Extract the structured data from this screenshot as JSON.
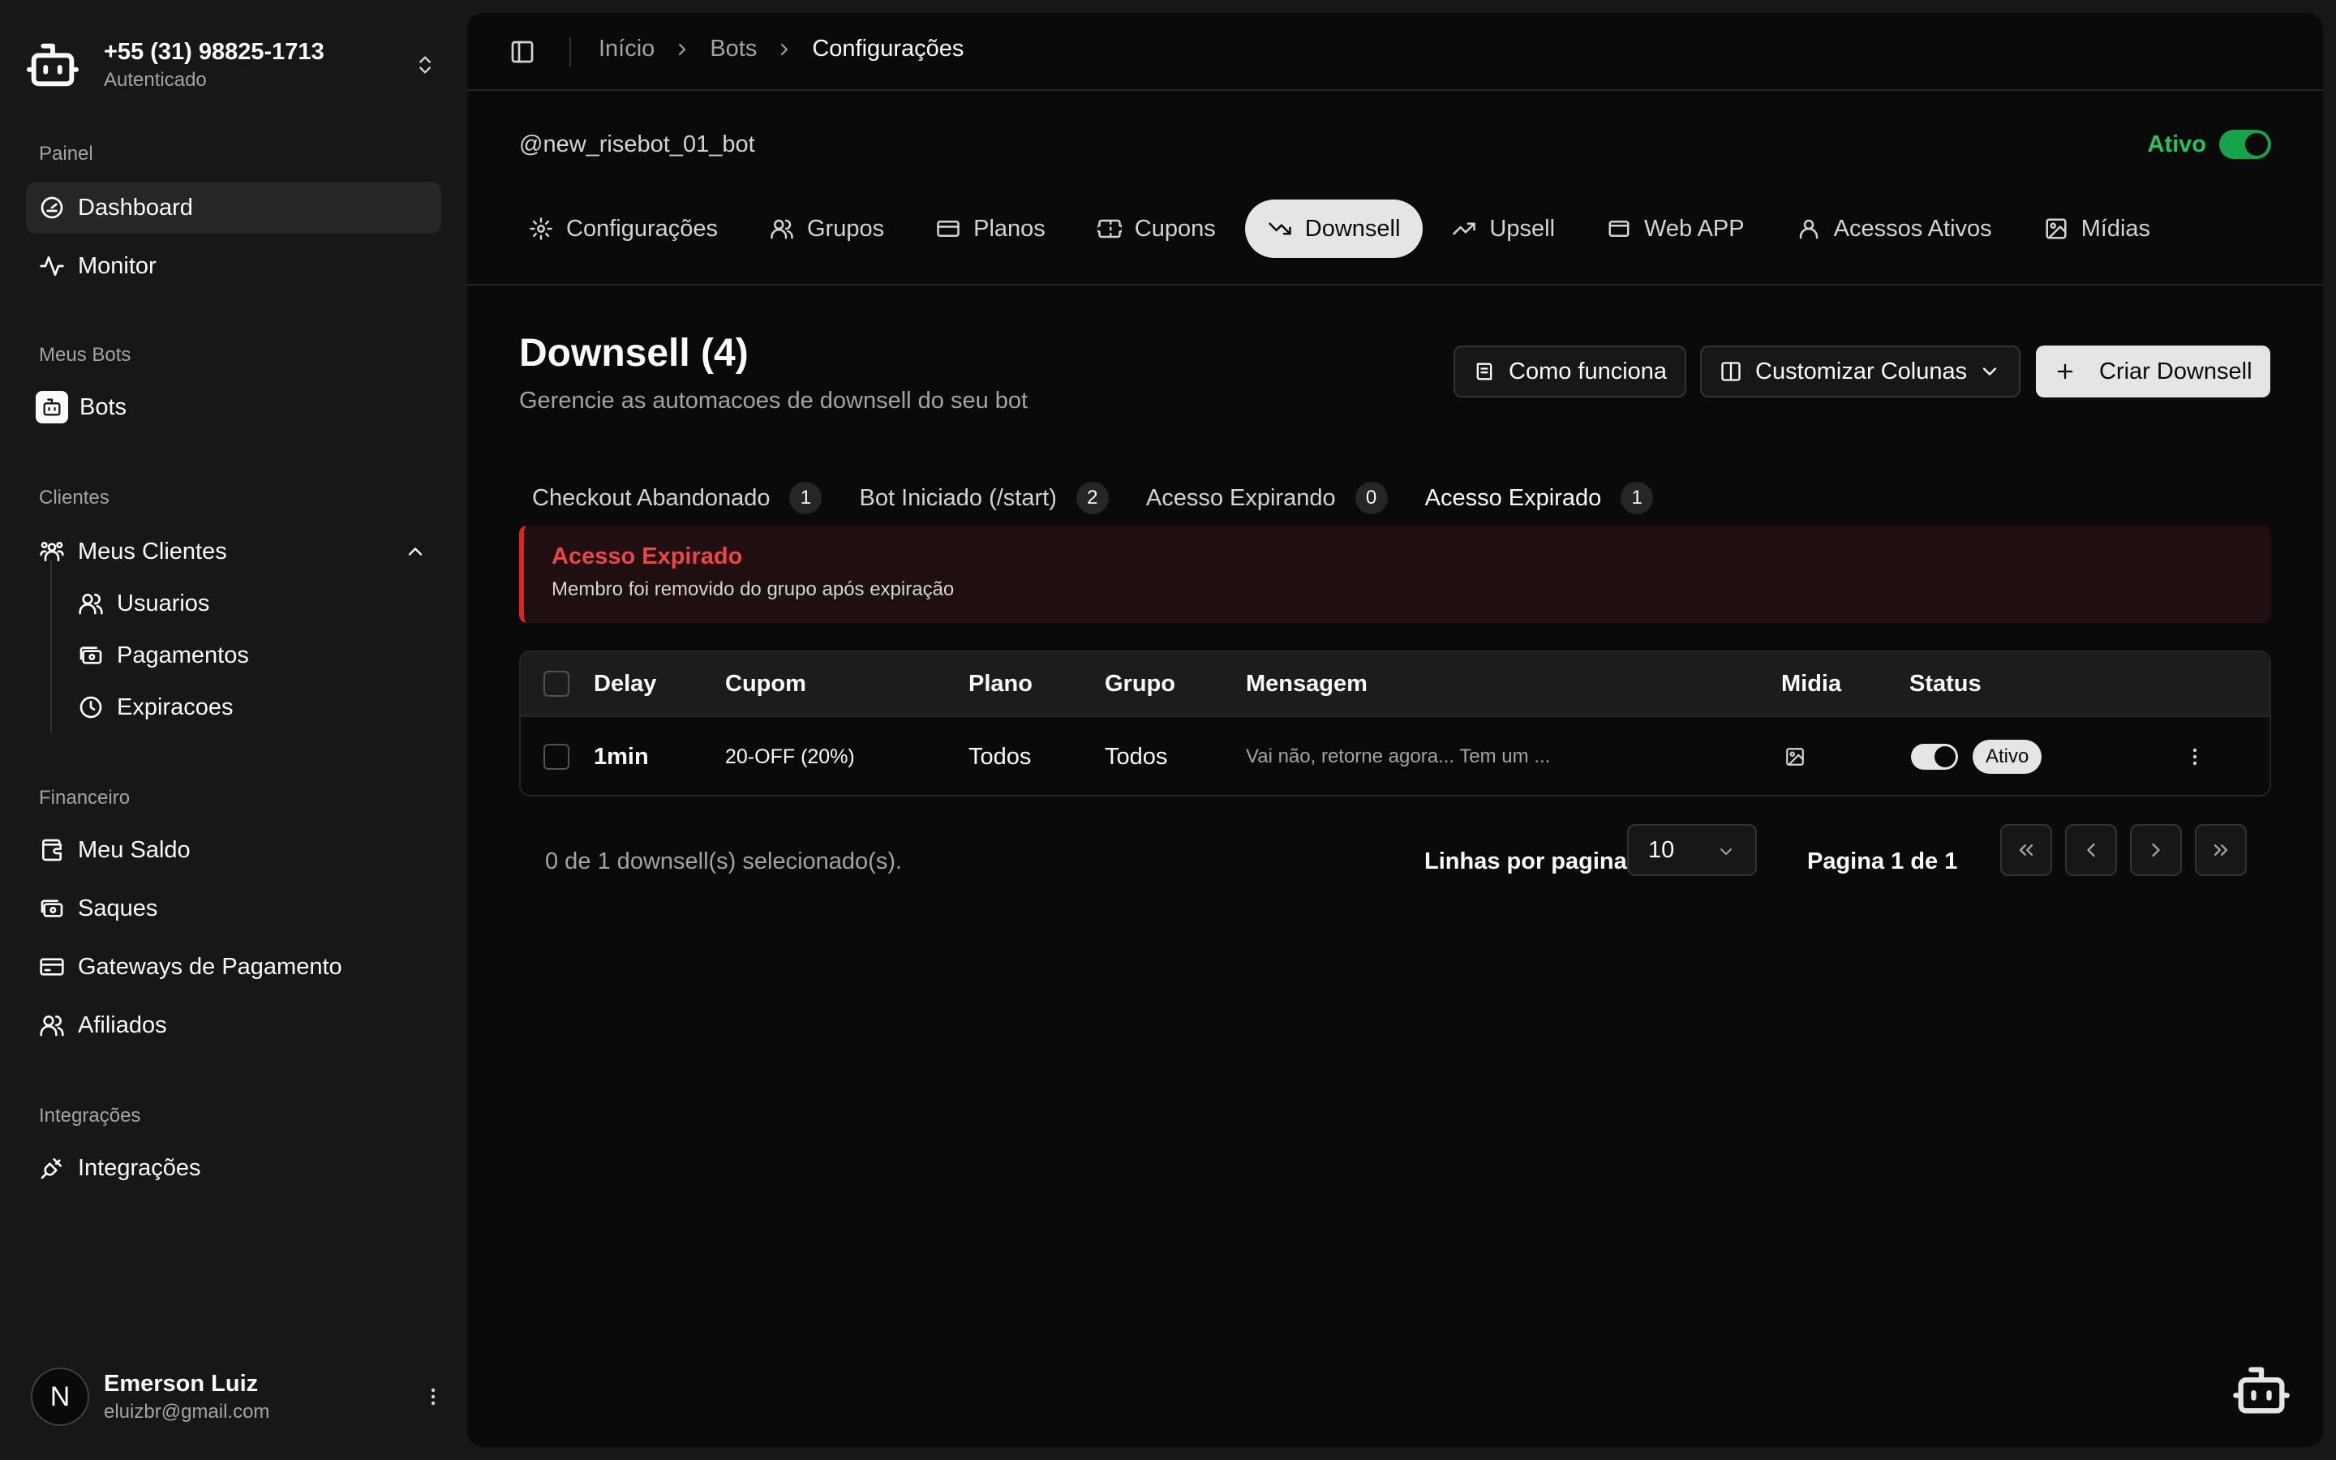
{
  "account": {
    "phone": "+55 (31) 98825-1713",
    "status": "Autenticado"
  },
  "sidebar": {
    "sections": [
      {
        "label": "Painel",
        "items": [
          {
            "label": "Dashboard",
            "icon": "gauge-icon"
          },
          {
            "label": "Monitor",
            "icon": "activity-icon"
          }
        ]
      },
      {
        "label": "Meus Bots",
        "items": [
          {
            "label": "Bots",
            "icon": "bot-icon"
          }
        ]
      },
      {
        "label": "Clientes",
        "items": [
          {
            "label": "Meus Clientes",
            "icon": "users-group-icon"
          }
        ],
        "subitems": [
          {
            "label": "Usuarios"
          },
          {
            "label": "Pagamentos"
          },
          {
            "label": "Expiracoes"
          }
        ]
      },
      {
        "label": "Financeiro",
        "items": [
          {
            "label": "Meu Saldo"
          },
          {
            "label": "Saques"
          },
          {
            "label": "Gateways de Pagamento"
          },
          {
            "label": "Afiliados"
          }
        ]
      },
      {
        "label": "Integrações",
        "items": [
          {
            "label": "Integrações"
          }
        ]
      }
    ]
  },
  "user": {
    "initial": "N",
    "name": "Emerson Luiz",
    "email": "eluizbr@gmail.com"
  },
  "breadcrumb": [
    "Início",
    "Bots",
    "Configurações"
  ],
  "bot": {
    "handle": "@new_risebot_01_bot",
    "status_label": "Ativo",
    "active": true
  },
  "tabs": [
    "Configurações",
    "Grupos",
    "Planos",
    "Cupons",
    "Downsell",
    "Upsell",
    "Web APP",
    "Acessos Ativos",
    "Mídias"
  ],
  "active_tab": "Downsell",
  "page": {
    "title": "Downsell (4)",
    "subtitle": "Gerencie as automacoes de downsell do seu bot",
    "btn_how": "Como funciona",
    "btn_columns": "Customizar Colunas",
    "btn_create": "Criar Downsell"
  },
  "subtabs": [
    {
      "label": "Checkout Abandonado",
      "count": "1"
    },
    {
      "label": "Bot Iniciado (/start)",
      "count": "2"
    },
    {
      "label": "Acesso Expirando",
      "count": "0"
    },
    {
      "label": "Acesso Expirado",
      "count": "1"
    }
  ],
  "alert": {
    "title": "Acesso Expirado",
    "description": "Membro foi removido do grupo após expiração",
    "color": "#ef4444"
  },
  "table": {
    "headers": [
      "Delay",
      "Cupom",
      "Plano",
      "Grupo",
      "Mensagem",
      "Midia",
      "Status"
    ],
    "rows": [
      {
        "delay": "1min",
        "cupom": "20-OFF (20%)",
        "plano": "Todos",
        "grupo": "Todos",
        "mensagem": "Vai não, retorne agora... Tem um ...",
        "midia_icon": "image-icon",
        "status_enabled": true,
        "status": "Ativo"
      }
    ]
  },
  "footer": {
    "selected": "0 de 1 downsell(s) selecionado(s).",
    "rows_label": "Linhas por pagina",
    "rows_value": "10",
    "page_label": "Pagina 1 de 1"
  },
  "colors": {
    "accent_green": "#22c55e",
    "danger": "#ef4444",
    "background": "#0a0a0a",
    "sidebar": "#171717"
  }
}
